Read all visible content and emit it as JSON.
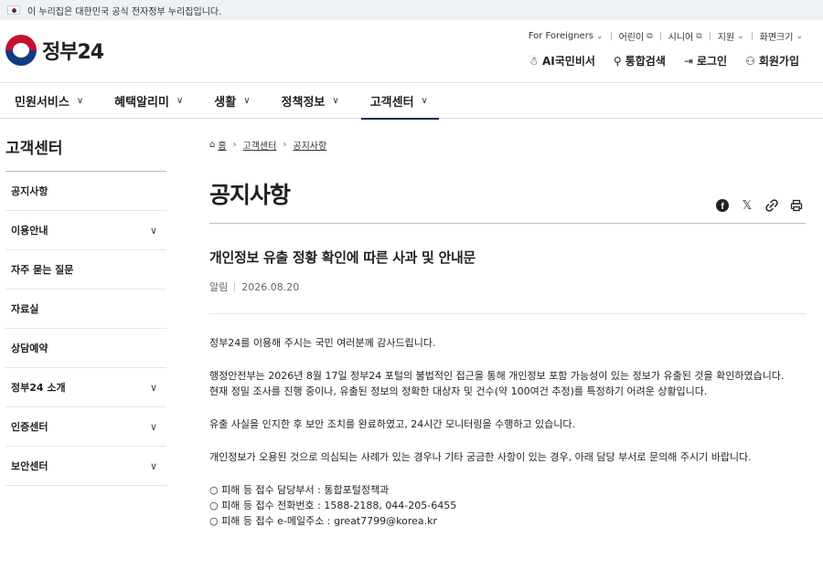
{
  "gov_banner": {
    "text": "이 누리집은 대한민국 공식 전자정부 누리집입니다."
  },
  "header": {
    "logo_text": "정부24",
    "util_links": [
      {
        "label": "For Foreigners",
        "icon": "chevron-down-icon"
      },
      {
        "label": "어린이",
        "icon": "external-link-icon"
      },
      {
        "label": "시니어",
        "icon": "external-link-icon"
      },
      {
        "label": "지원",
        "icon": "chevron-down-icon"
      },
      {
        "label": "화면크기",
        "icon": "chevron-down-icon"
      }
    ],
    "main_links": [
      {
        "label": "AI국민비서",
        "icon": "ai-assistant-icon"
      },
      {
        "label": "통합검색",
        "icon": "search-icon"
      },
      {
        "label": "로그인",
        "icon": "login-icon"
      },
      {
        "label": "회원가입",
        "icon": "signup-icon"
      }
    ]
  },
  "gnb": {
    "items": [
      {
        "label": "민원서비스"
      },
      {
        "label": "혜택알리미"
      },
      {
        "label": "생활"
      },
      {
        "label": "정책정보"
      },
      {
        "label": "고객센터",
        "active": true
      }
    ]
  },
  "sidebar": {
    "title": "고객센터",
    "items": [
      {
        "label": "공지사항",
        "expandable": false
      },
      {
        "label": "이용안내",
        "expandable": true
      },
      {
        "label": "자주 묻는 질문",
        "expandable": false
      },
      {
        "label": "자료실",
        "expandable": false
      },
      {
        "label": "상담예약",
        "expandable": false
      },
      {
        "label": "정부24 소개",
        "expandable": true
      },
      {
        "label": "인증센터",
        "expandable": true
      },
      {
        "label": "보안센터",
        "expandable": true
      }
    ]
  },
  "breadcrumb": {
    "home": "홈",
    "level1": "고객센터",
    "level2": "공지사항"
  },
  "page_title": "공지사항",
  "share_icons": [
    "facebook-icon",
    "x-icon",
    "link-icon",
    "print-icon"
  ],
  "notice": {
    "title": "개인정보 유출 정황 확인에 따른 사과 및 안내문",
    "category": "알림",
    "date": "2026.08.20",
    "paragraphs": [
      "정부24를 이용해 주시는 국민 여러분께 감사드립니다.",
      "행정안전부는 2026년 8월 17일 정부24 포털의 불법적인 접근을 통해 개인정보 포함 가능성이 있는 정보가 유출된 것을 확인하였습니다.",
      "현재 정밀 조사를 진행 중이나, 유출된 정보의 정확한 대상자 및 건수(약 100여건 추정)를 특정하기 어려운 상황입니다.",
      "유출 사실을 인지한 후 보안 조치를 완료하였고, 24시간 모니터링을 수행하고 있습니다.",
      "개인정보가 오용된 것으로 의심되는 사례가 있는 경우나 기타 궁금한 사항이 있는 경우, 아래 담당 부서로 문의해 주시기 바랍니다."
    ],
    "contacts": [
      "○ 피해 등 접수 담당부서 : 통합포털정책과",
      "○ 피해 등 접수 전화번호 : 1588-2188, 044-205-6455",
      "○ 피해 등 접수 e-메일주소 : great7799@korea.kr"
    ]
  }
}
